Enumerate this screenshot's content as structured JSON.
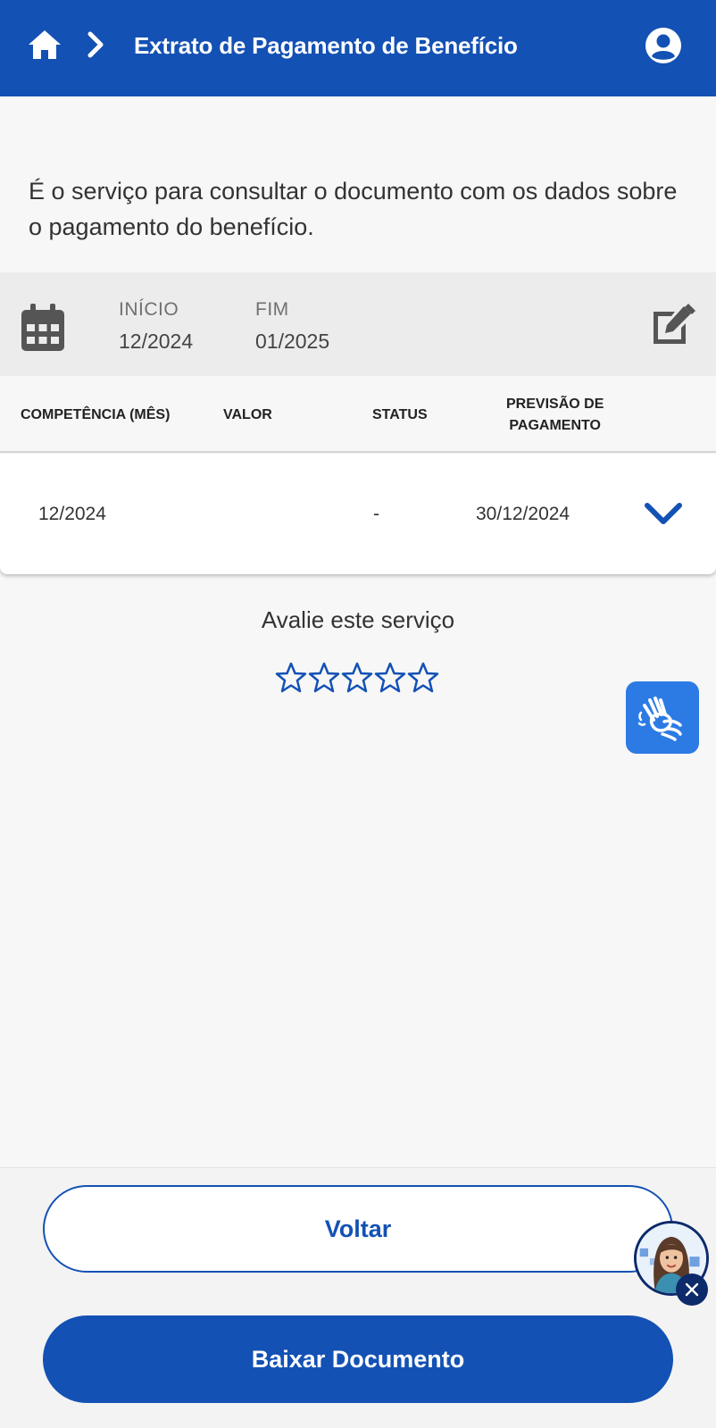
{
  "header": {
    "title": "Extrato de Pagamento de Benefício",
    "home_icon": "home-icon",
    "breadcrumb_icon": "chevron-right-icon",
    "user_icon": "user-account-icon",
    "color": "#1351b4"
  },
  "description": "É o serviço para consultar o documento com os dados sobre o pagamento do benefício.",
  "period": {
    "start_label": "INÍCIO",
    "start_value": "12/2024",
    "end_label": "FIM",
    "end_value": "01/2025",
    "calendar_icon": "calendar-icon",
    "edit_icon": "edit-icon"
  },
  "table": {
    "headers": {
      "competencia": "COMPETÊNCIA (MÊS)",
      "valor": "VALOR",
      "status": "STATUS",
      "previsao_line1": "PREVISÃO DE",
      "previsao_line2": "PAGAMENTO"
    },
    "rows": [
      {
        "competencia": "12/2024",
        "valor": "",
        "status": "-",
        "previsao": "30/12/2024"
      }
    ],
    "expand_icon": "chevron-down-icon"
  },
  "rating": {
    "title": "Avalie este serviço",
    "stars": 0,
    "max_stars": 5
  },
  "accessibility": {
    "icon": "sign-language-icon"
  },
  "actions": {
    "back_label": "Voltar",
    "download_label": "Baixar Documento"
  },
  "assistant": {
    "avatar_icon": "assistant-avatar-icon",
    "close_icon": "close-icon"
  }
}
